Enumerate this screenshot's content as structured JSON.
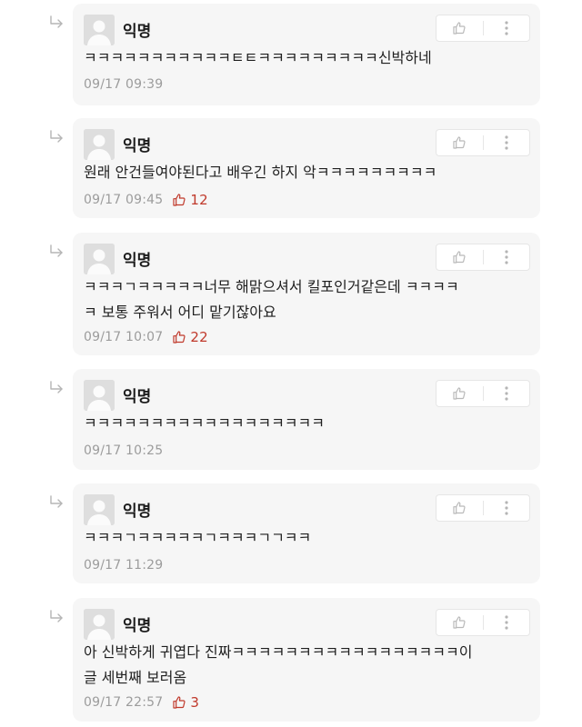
{
  "colors": {
    "card_bg": "#f6f6f6",
    "text": "#1f1f1f",
    "meta": "#9c9c9c",
    "like_accent": "#c0392b"
  },
  "icons": {
    "reply": "reply-arrow-icon",
    "like": "thumbs-up-icon",
    "more": "vertical-dots-icon",
    "avatar": "default-user-avatar"
  },
  "comments": [
    {
      "author": "익명",
      "lines": [
        "ㅋㅋㅋㅋㅋㅋㅋㅋㅋㅋㅋㅌㅌㅋㅋㅋㅋㅋㅋㅋㅋㅋ신박하네"
      ],
      "time": "09/17 09:39",
      "likes": ""
    },
    {
      "author": "익명",
      "lines": [
        "원래 안건들여야된다고 배우긴 하지 악ㅋㅋㅋㅋㅋㅋㅋㅋㅋ"
      ],
      "time": "09/17 09:45",
      "likes": "12"
    },
    {
      "author": "익명",
      "lines": [
        "ㅋㅋㅋㄱㅋㅋㅋㅋㅋ너무 해맑으셔서 킬포인거같은데 ㅋㅋㅋㅋ",
        "ㅋ 보통 주워서 어디 맡기잖아요"
      ],
      "time": "09/17 10:07",
      "likes": "22"
    },
    {
      "author": "익명",
      "lines": [
        "ㅋㅋㅋㅋㅋㅋㅋㅋㅋㅋㅋㅋㅋㅋㅋㅋㅋㅋ"
      ],
      "time": "09/17 10:25",
      "likes": ""
    },
    {
      "author": "익명",
      "lines": [
        "ㅋㅋㅋㄱㅋㅋㅋㅋㅋㄱㅋㅋㅋㄱㄱㅋㅋ"
      ],
      "time": "09/17 11:29",
      "likes": ""
    },
    {
      "author": "익명",
      "lines": [
        "아 신박하게 귀엽다 진짜ㅋㅋㅋㅋㅋㅋㅋㅋㅋㅋㅋㅋㅋㅋㅋㅋㅋ이",
        "글 세번째 보러옴"
      ],
      "time": "09/17 22:57",
      "likes": "3"
    }
  ]
}
